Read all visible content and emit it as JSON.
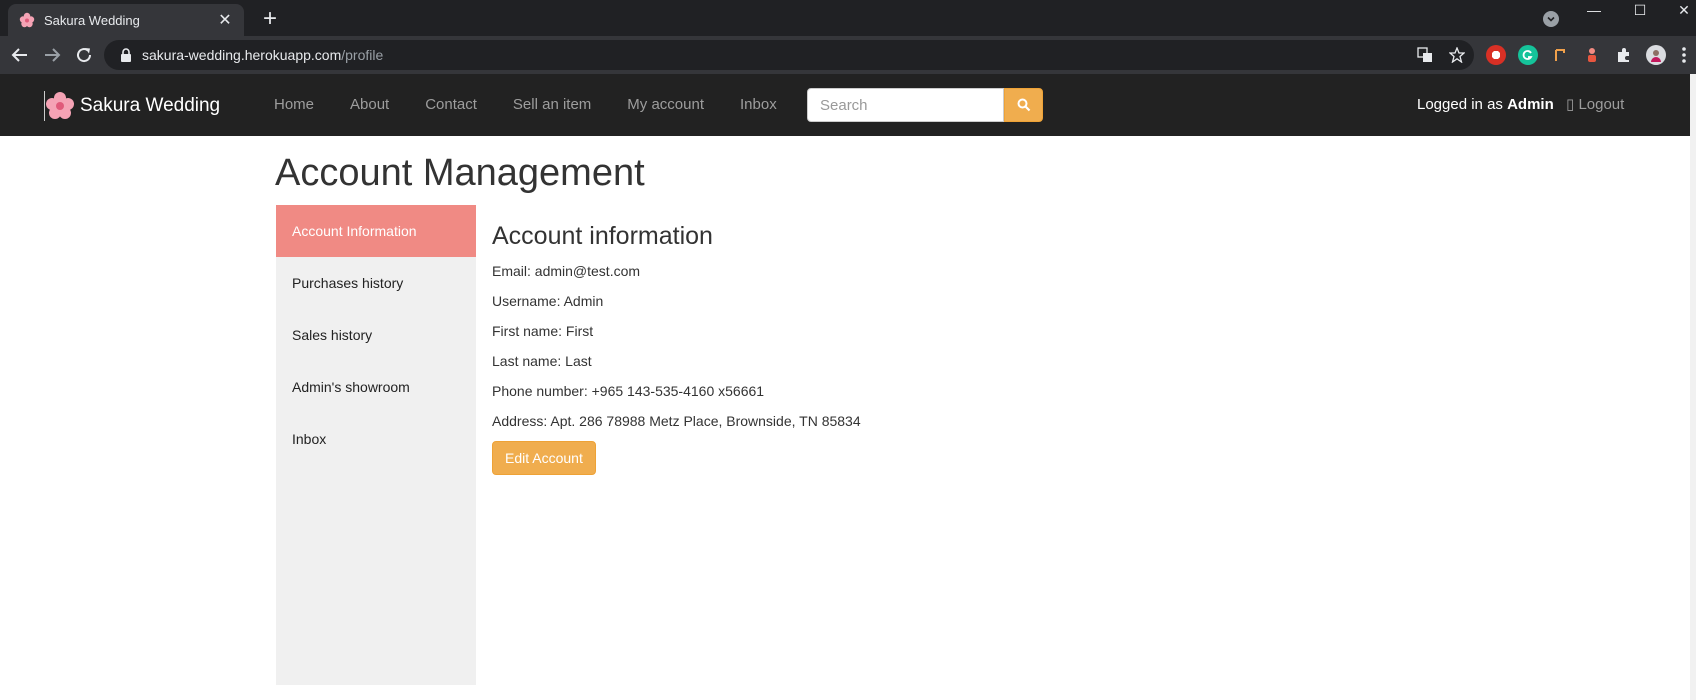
{
  "browser": {
    "tab_title": "Sakura Wedding",
    "close_glyph": "✕",
    "new_tab_glyph": "+",
    "url_host": "sakura-wedding.herokuapp.com",
    "url_path": "/profile",
    "win_minimize": "—",
    "win_maximize": "☐",
    "win_close": "✕"
  },
  "site": {
    "brand": "Sakura Wedding",
    "nav": [
      "Home",
      "About",
      "Contact",
      "Sell an item",
      "My account",
      "Inbox"
    ],
    "search_placeholder": "Search",
    "logged_in_prefix": "Logged in as ",
    "logged_in_user": "Admin",
    "logout": "Logout"
  },
  "page": {
    "title": "Account Management",
    "sidebar": [
      "Account Information",
      "Purchases history",
      "Sales history",
      "Admin's showroom",
      "Inbox"
    ],
    "active_sidebar_index": 0,
    "section_title": "Account information",
    "fields": [
      "Email: admin@test.com",
      "Username: Admin",
      "First name: First",
      "Last name: Last",
      "Phone number: +965 143-535-4160 x56661",
      "Address: Apt. 286 78988 Metz Place, Brownside, TN 85834"
    ],
    "edit_button": "Edit Account"
  },
  "colors": {
    "navbar": "#222222",
    "accent": "#f0ad4e",
    "sidebar_active": "#f08a84"
  }
}
